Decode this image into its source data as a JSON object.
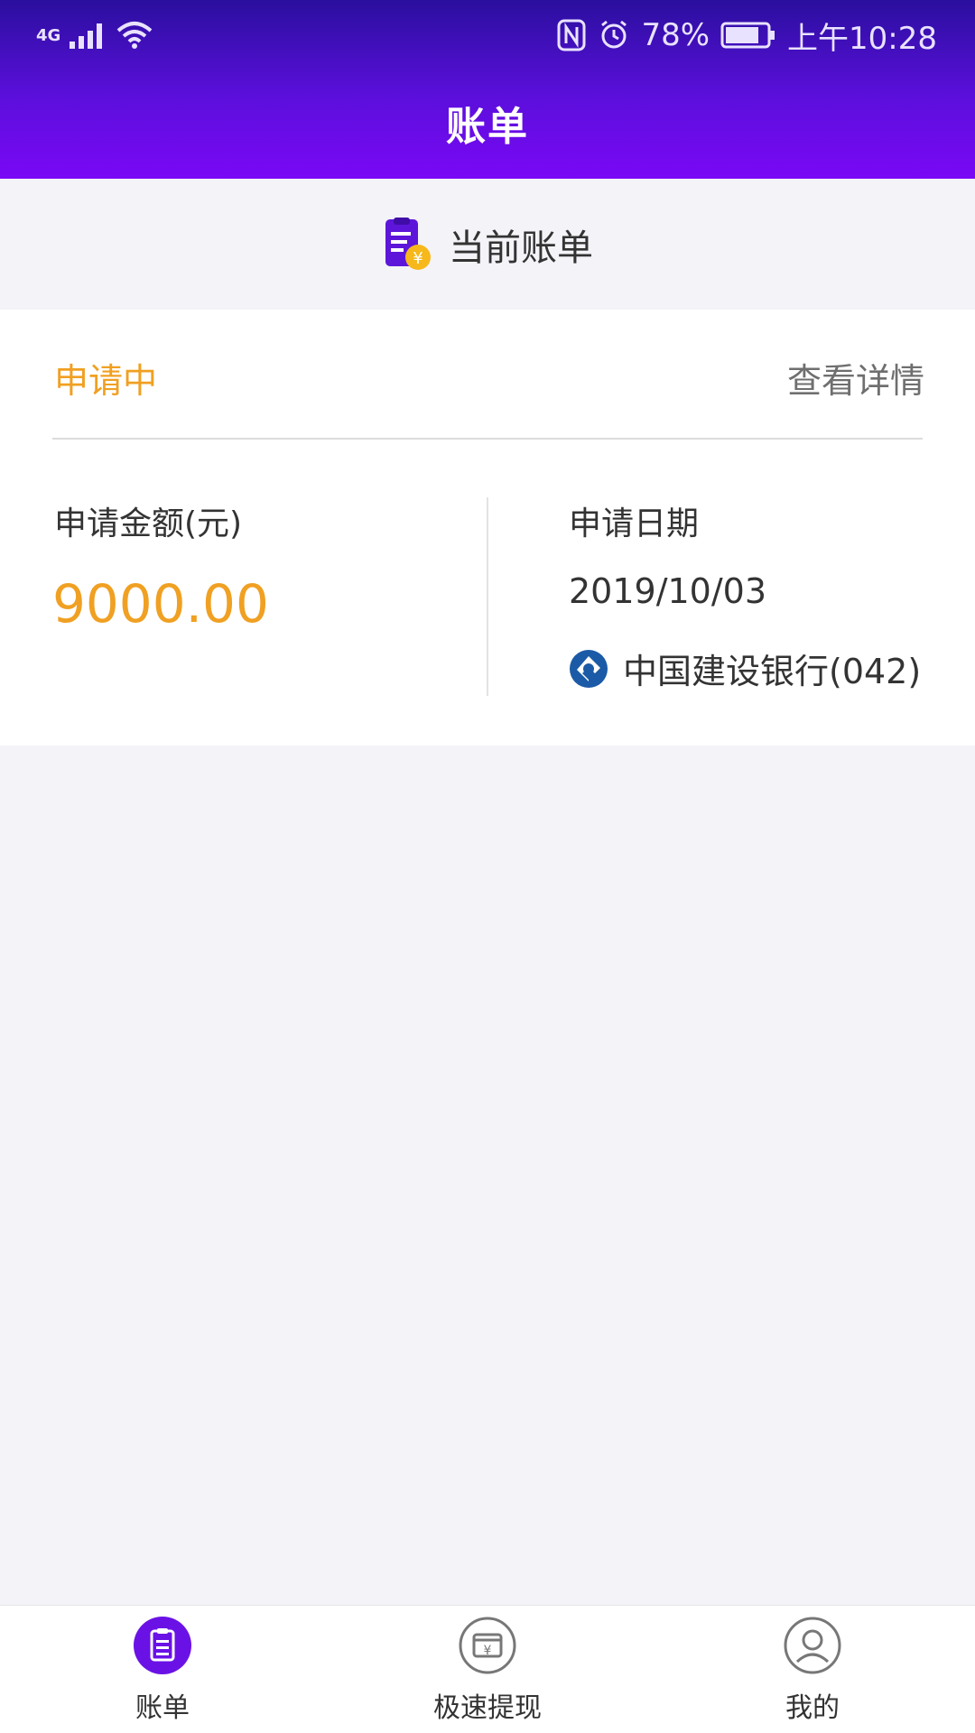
{
  "status_bar": {
    "network": "4G",
    "battery_percent": "78%",
    "time": "上午10:28"
  },
  "header": {
    "title": "账单"
  },
  "current_bill": {
    "label": "当前账单"
  },
  "bill_card": {
    "status": "申请中",
    "detail_link": "查看详情",
    "amount_label": "申请金额(元)",
    "amount_value": "9000.00",
    "date_label": "申请日期",
    "date_value": "2019/10/03",
    "bank_name": "中国建设银行(042)"
  },
  "bottom_nav": {
    "items": [
      {
        "label": "账单",
        "icon": "bill-icon",
        "active": true
      },
      {
        "label": "极速提现",
        "icon": "cash-withdraw-icon",
        "active": false
      },
      {
        "label": "我的",
        "icon": "profile-icon",
        "active": false
      }
    ]
  },
  "colors": {
    "accent_purple": "#6a12e6",
    "status_orange": "#f0a022",
    "ccb_blue": "#1b5aa6"
  }
}
